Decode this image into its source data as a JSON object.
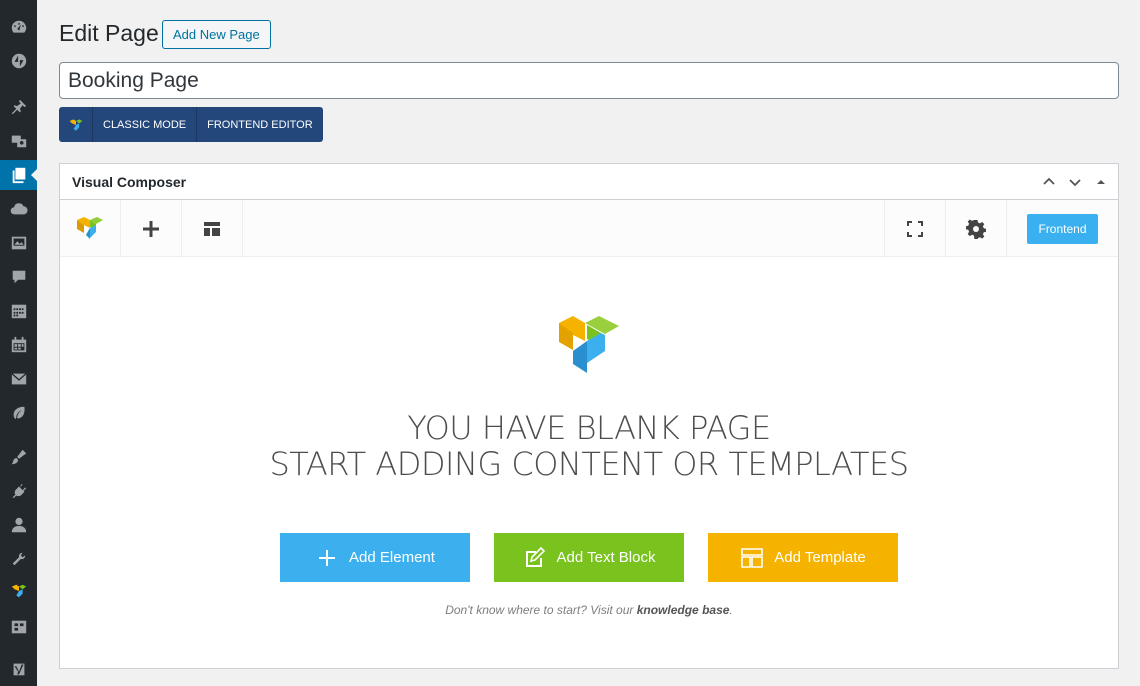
{
  "header": {
    "title": "Edit Page",
    "add_new_label": "Add New Page"
  },
  "post": {
    "title_value": "Booking Page"
  },
  "mode_switch": {
    "classic_label": "CLASSIC MODE",
    "frontend_editor_label": "FRONTEND EDITOR"
  },
  "composer": {
    "box_title": "Visual Composer",
    "frontend_label": "Frontend",
    "headline_line1": "YOU HAVE BLANK PAGE",
    "headline_line2": "START ADDING CONTENT OR TEMPLATES",
    "add_element_label": "Add Element",
    "add_text_block_label": "Add Text Block",
    "add_template_label": "Add Template",
    "hint_prefix": "Don't know where to start? Visit our ",
    "hint_link": "knowledge base",
    "hint_suffix": "."
  },
  "sidebar": {
    "icons": [
      "dashboard-icon",
      "jetpack-icon",
      "posts-pin-icon",
      "media-icon",
      "pages-icon",
      "cloud-icon",
      "portfolio-icon",
      "comments-icon",
      "calendar-grid-icon",
      "calendar-icon",
      "mail-icon",
      "leaf-icon",
      "appearance-brush-icon",
      "plugins-icon",
      "users-icon",
      "tools-wrench-icon",
      "visual-composer-icon",
      "settings-icon",
      "yoast-icon"
    ],
    "active": "pages-icon"
  },
  "colors": {
    "sidebar_bg": "#23282d",
    "active_menu": "#0073aa",
    "mode_switch_bg": "#23477a",
    "frontend_button": "#3bb0f0",
    "add_element": "#3cb0ee",
    "add_text_block": "#7ac31e",
    "add_template": "#f5b300"
  }
}
